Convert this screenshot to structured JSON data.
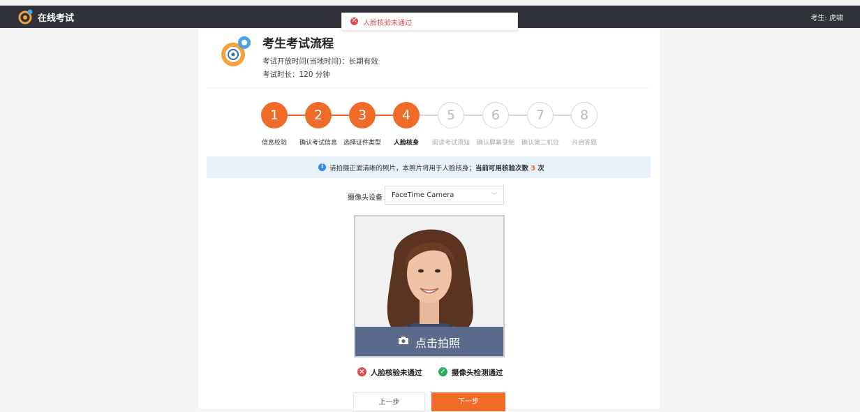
{
  "header": {
    "app_title": "在线考试",
    "user_label": "考生: 虎啸"
  },
  "toast": {
    "message": "人脸核验未通过"
  },
  "exam": {
    "title": "考生考试流程",
    "open_time": "考试开放时间(当地时间)：长期有效",
    "duration": "考试时长：120 分钟"
  },
  "steps": [
    {
      "num": "1",
      "label": "信息校验",
      "state": "done"
    },
    {
      "num": "2",
      "label": "确认考试信息",
      "state": "done"
    },
    {
      "num": "3",
      "label": "选择证件类型",
      "state": "done"
    },
    {
      "num": "4",
      "label": "人脸核身",
      "state": "current"
    },
    {
      "num": "5",
      "label": "阅读考试须知",
      "state": "todo"
    },
    {
      "num": "6",
      "label": "确认屏幕录制",
      "state": "todo"
    },
    {
      "num": "7",
      "label": "确认第二机位",
      "state": "todo"
    },
    {
      "num": "8",
      "label": "开启答题",
      "state": "todo"
    }
  ],
  "banner": {
    "text": "请拍摄正面清晰的照片，本照片将用于人脸核身；",
    "strong": "当前可用核验次数 ",
    "count": "3",
    "unit": " 次"
  },
  "camera": {
    "label": "摄像头设备",
    "selected": "FaceTime Camera"
  },
  "preview": {
    "shoot_label": "点击拍照"
  },
  "status": {
    "face_check": "人脸核验未通过",
    "camera_check": "摄像头检测通过"
  },
  "buttons": {
    "prev": "上一步",
    "next": "下一步"
  },
  "colors": {
    "accent": "#f06a28",
    "topbar": "#2f3238",
    "error": "#e04b4b",
    "success": "#27ae60",
    "info": "#2d8cf0"
  }
}
